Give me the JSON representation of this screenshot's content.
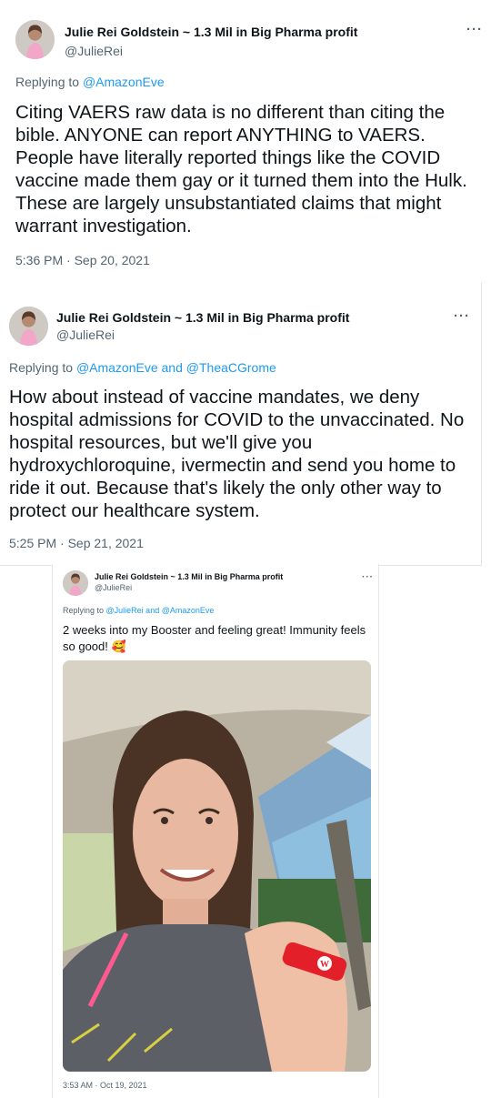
{
  "tweets": [
    {
      "name": "Julie Rei Goldstein ~ 1.3 Mil in Big Pharma profit",
      "handle": "@JulieRei",
      "more": "···",
      "reply_prefix": "Replying to ",
      "reply_users": "@AmazonEve",
      "text": "Citing VAERS raw data is no different than citing the bible. ANYONE can report ANYTHING to VAERS. People have literally reported things like the COVID vaccine made them gay or it turned them into the Hulk. These are largely unsubstantiated claims that might warrant investigation.",
      "time": "5:36 PM · Sep 20, 2021"
    },
    {
      "name": "Julie Rei Goldstein ~ 1.3 Mil in Big Pharma profit",
      "handle": "@JulieRei",
      "more": "···",
      "reply_prefix": "Replying to ",
      "reply_users": "@AmazonEve and @TheaCGrome",
      "text": "How about instead of vaccine mandates, we deny hospital admissions for COVID to the unvaccinated. No hospital resources, but we'll give you hydroxychloroquine, ivermectin and send you home to ride it out. Because that's likely the only other way to protect our healthcare system.",
      "time": "5:25 PM · Sep 21, 2021"
    },
    {
      "name": "Julie Rei Goldstein ~ 1.3 Mil in Big Pharma profit",
      "handle": "@JulieRei",
      "more": "···",
      "reply_prefix": "Replying to ",
      "reply_users": "@JulieRei and @AmazonEve",
      "text": "2 weeks into my Booster and feeling great! Immunity feels so good! 🥰",
      "time": "3:53 AM · Oct 19, 2021",
      "photo_bandage_letter": "W"
    }
  ],
  "colors": {
    "link": "#1d9bf0",
    "secondary_text": "#536471",
    "primary_text": "#0f1419"
  },
  "icons": {
    "more": "more-dots-icon"
  }
}
